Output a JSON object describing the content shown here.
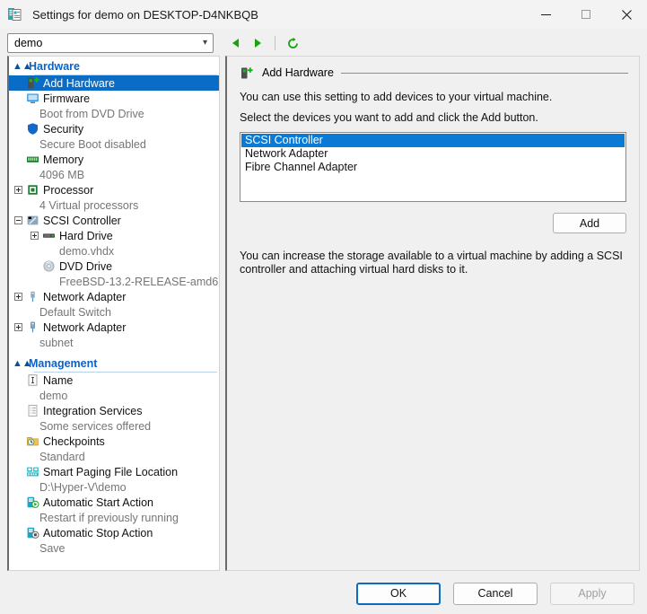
{
  "window": {
    "title": "Settings for demo on DESKTOP-D4NKBQB",
    "icon": "settings-vm-icon",
    "controls": {
      "minimize": "minimize-icon",
      "maximize": "maximize-icon",
      "close": "close-icon"
    }
  },
  "toolbar": {
    "vm_selector_value": "demo",
    "back": "back-arrow-icon",
    "forward": "forward-arrow-icon",
    "refresh": "refresh-icon"
  },
  "tree": {
    "sections": [
      {
        "label": "Hardware",
        "items": [
          {
            "label": "Add Hardware",
            "sub": "",
            "icon": "add-hardware-icon",
            "expander": "",
            "selected": true,
            "indent": 0
          },
          {
            "label": "Firmware",
            "sub": "Boot from DVD Drive",
            "icon": "firmware-icon",
            "expander": "",
            "selected": false,
            "indent": 0
          },
          {
            "label": "Security",
            "sub": "Secure Boot disabled",
            "icon": "security-shield-icon",
            "expander": "",
            "selected": false,
            "indent": 0
          },
          {
            "label": "Memory",
            "sub": "4096 MB",
            "icon": "memory-icon",
            "expander": "",
            "selected": false,
            "indent": 0
          },
          {
            "label": "Processor",
            "sub": "4 Virtual processors",
            "icon": "processor-icon",
            "expander": "plus",
            "selected": false,
            "indent": 0
          },
          {
            "label": "SCSI Controller",
            "sub": "",
            "icon": "scsi-controller-icon",
            "expander": "minus",
            "selected": false,
            "indent": 0
          },
          {
            "label": "Hard Drive",
            "sub": "demo.vhdx",
            "icon": "hard-drive-icon",
            "expander": "plus",
            "selected": false,
            "indent": 1
          },
          {
            "label": "DVD Drive",
            "sub": "FreeBSD-13.2-RELEASE-amd6…",
            "icon": "dvd-drive-icon",
            "expander": "",
            "selected": false,
            "indent": 1
          },
          {
            "label": "Network Adapter",
            "sub": "Default Switch",
            "icon": "network-adapter-icon",
            "expander": "plus",
            "selected": false,
            "indent": 0
          },
          {
            "label": "Network Adapter",
            "sub": "subnet",
            "icon": "network-adapter-icon",
            "expander": "plus",
            "selected": false,
            "indent": 0
          }
        ]
      },
      {
        "label": "Management",
        "items": [
          {
            "label": "Name",
            "sub": "demo",
            "icon": "name-icon",
            "expander": "",
            "selected": false,
            "indent": 0
          },
          {
            "label": "Integration Services",
            "sub": "Some services offered",
            "icon": "integration-services-icon",
            "expander": "",
            "selected": false,
            "indent": 0
          },
          {
            "label": "Checkpoints",
            "sub": "Standard",
            "icon": "checkpoints-icon",
            "expander": "",
            "selected": false,
            "indent": 0
          },
          {
            "label": "Smart Paging File Location",
            "sub": "D:\\Hyper-V\\demo",
            "icon": "smart-paging-icon",
            "expander": "",
            "selected": false,
            "indent": 0
          },
          {
            "label": "Automatic Start Action",
            "sub": "Restart if previously running",
            "icon": "automatic-start-icon",
            "expander": "",
            "selected": false,
            "indent": 0
          },
          {
            "label": "Automatic Stop Action",
            "sub": "Save",
            "icon": "automatic-stop-icon",
            "expander": "",
            "selected": false,
            "indent": 0
          }
        ]
      }
    ]
  },
  "pane": {
    "header": "Add Hardware",
    "header_icon": "add-hardware-icon",
    "intro_line1": "You can use this setting to add devices to your virtual machine.",
    "intro_line2": "Select the devices you want to add and click the Add button.",
    "device_list": [
      "SCSI Controller",
      "Network Adapter",
      "Fibre Channel Adapter"
    ],
    "selected_device": "SCSI Controller",
    "add_button": "Add",
    "description": "You can increase the storage available to a virtual machine by adding a SCSI controller and attaching virtual hard disks to it."
  },
  "footer": {
    "ok": "OK",
    "cancel": "Cancel",
    "apply": "Apply"
  },
  "colors": {
    "selection_blue": "#0a6cc4",
    "list_selection_blue": "#0a7ad4",
    "section_heading_blue": "#0a62c7",
    "accent_green": "#16a50f",
    "default_button_border": "#0f6cbd"
  }
}
